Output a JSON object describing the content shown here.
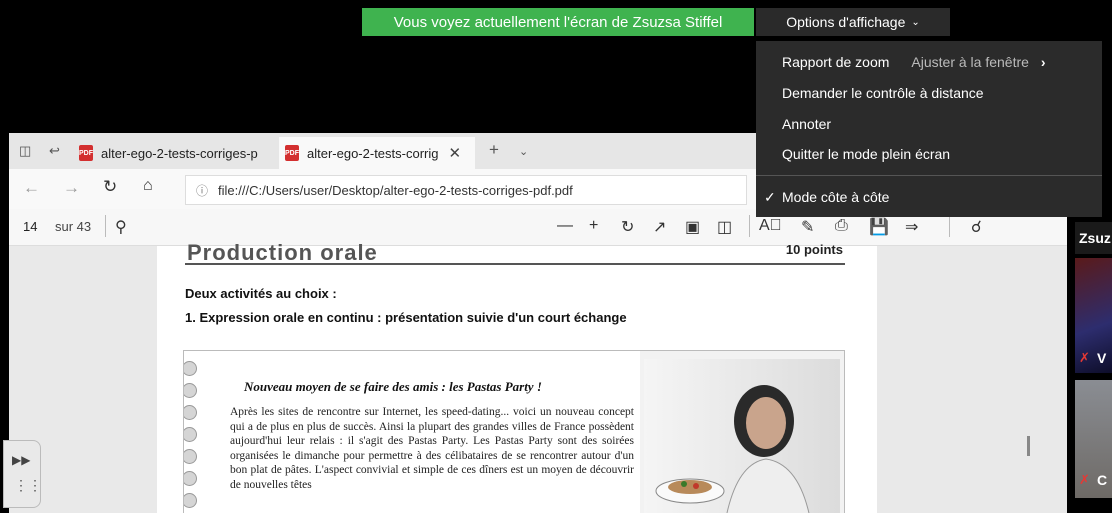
{
  "zoom": {
    "share_banner": "Vous voyez actuellement l'écran de Zsuzsa Stiffel",
    "view_options": "Options d'affichage",
    "menu": {
      "zoom_ratio": "Rapport de zoom",
      "zoom_ratio_value": "Ajuster à la fenêtre",
      "request_remote_control": "Demander le contrôle à distance",
      "annotate": "Annoter",
      "exit_fullscreen": "Quitter le mode plein écran",
      "side_by_side": "Mode côte à côte"
    },
    "participants": {
      "first_name_partial": "Zsuz",
      "second_initial": "V",
      "third_initial": "C"
    }
  },
  "browser": {
    "tabs": [
      {
        "label": "alter-ego-2-tests-corriges-p"
      },
      {
        "label": "alter-ego-2-tests-corrig"
      }
    ],
    "address": "file:///C:/Users/user/Desktop/alter-ego-2-tests-corriges-pdf.pdf",
    "pdf_page_current": "14",
    "pdf_page_total": "sur 43"
  },
  "document": {
    "section_title": "Production orale",
    "points": "10 points",
    "choice_heading": "Deux activités au choix :",
    "task_heading": "1. Expression orale en continu : présentation suivie d'un court échange",
    "article_title": "Nouveau moyen de se faire des amis : les Pastas Party !",
    "article_body": "Après les sites de rencontre sur Internet, les speed-dating... voici un nouveau concept qui a de plus en plus de succès. Ainsi la plupart des grandes villes de France possèdent aujourd'hui leur relais : il s'agit des Pastas Party. Les Pastas Party sont des soirées organisées le dimanche pour permettre à des célibataires de se rencontrer autour d'un bon plat de pâtes. L'aspect convivial et simple de ces dîners est un moyen de découvrir de nouvelles têtes"
  },
  "colors": {
    "banner_green": "#3fb34f",
    "menu_bg": "#2b2b2b",
    "pdf_icon_red": "#d32f2f"
  }
}
